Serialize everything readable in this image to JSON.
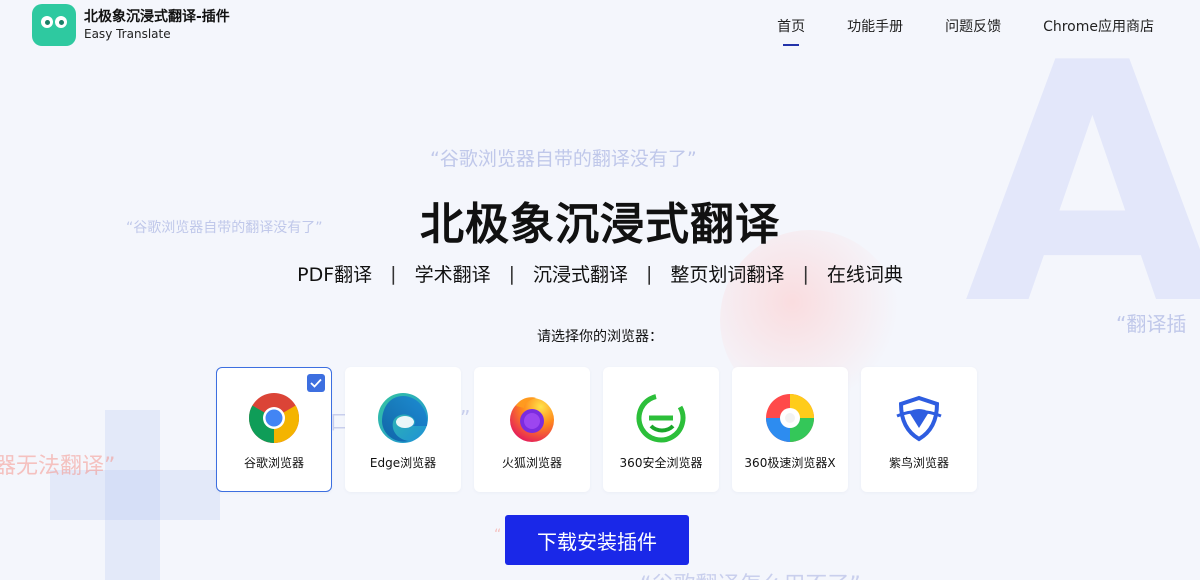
{
  "header": {
    "logo_title": "北极象沉浸式翻译-插件",
    "logo_subtitle": "Easy Translate",
    "nav": [
      {
        "label": "首页",
        "active": true
      },
      {
        "label": "功能手册"
      },
      {
        "label": "问题反馈"
      },
      {
        "label": "Chrome应用商店"
      }
    ]
  },
  "background": {
    "big_letter": "A",
    "quotes": [
      "“谷歌浏览器自带的翻译没有了”",
      "“谷歌浏览器自带的翻译没有了”",
      "“翻译插",
      "器无法翻译”",
      "“谷歌翻译怎么用不了”",
      "口",
      "”",
      "“"
    ]
  },
  "hero": {
    "title": "北极象沉浸式翻译",
    "features": [
      "PDF翻译",
      "学术翻译",
      "沉浸式翻译",
      "整页划词翻译",
      "在线词典"
    ],
    "separator": "|"
  },
  "browser_select": {
    "label": "请选择你的浏览器：",
    "browsers": [
      {
        "name": "谷歌浏览器",
        "icon": "chrome-icon",
        "selected": true
      },
      {
        "name": "Edge浏览器",
        "icon": "edge-icon",
        "selected": false
      },
      {
        "name": "火狐浏览器",
        "icon": "firefox-icon",
        "selected": false
      },
      {
        "name": "360安全浏览器",
        "icon": "360-safe-icon",
        "selected": false
      },
      {
        "name": "360极速浏览器X",
        "icon": "360-speed-icon",
        "selected": false
      },
      {
        "name": "紫鸟浏览器",
        "icon": "ziniao-icon",
        "selected": false
      }
    ]
  },
  "download_button": "下载安装插件",
  "colors": {
    "accent": "#1a28e8",
    "selected_border": "#3d6fe0",
    "logo_green": "#2ec9a0"
  }
}
